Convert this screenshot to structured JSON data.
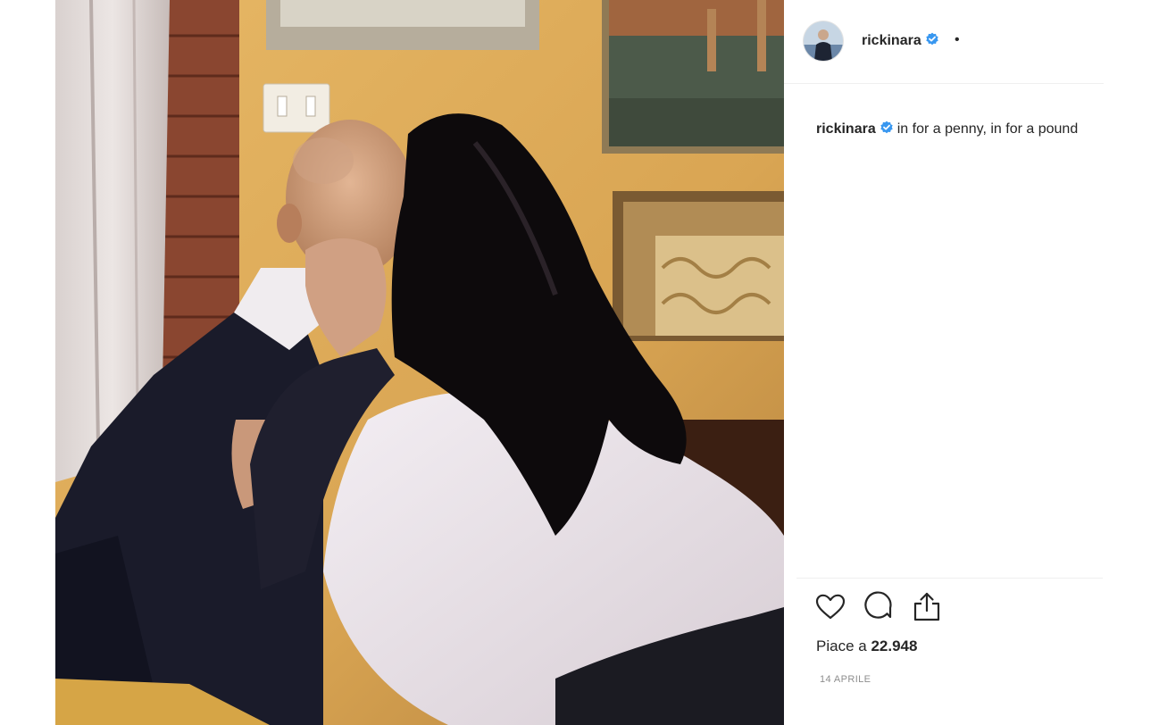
{
  "post": {
    "username": "rickinara",
    "header_separator": "•",
    "caption_text": "in for a penny, in for a pound",
    "likes_prefix": "Piace a",
    "likes_count": "22.948",
    "date": "14 APRILE"
  },
  "icons": {
    "verified": "verified-badge-icon",
    "like": "heart-icon",
    "comment": "comment-bubble-icon",
    "share": "share-icon"
  },
  "colors": {
    "verified_blue": "#3897f0",
    "text": "#262626",
    "muted": "#8e8e8e",
    "divider": "#efefef"
  }
}
